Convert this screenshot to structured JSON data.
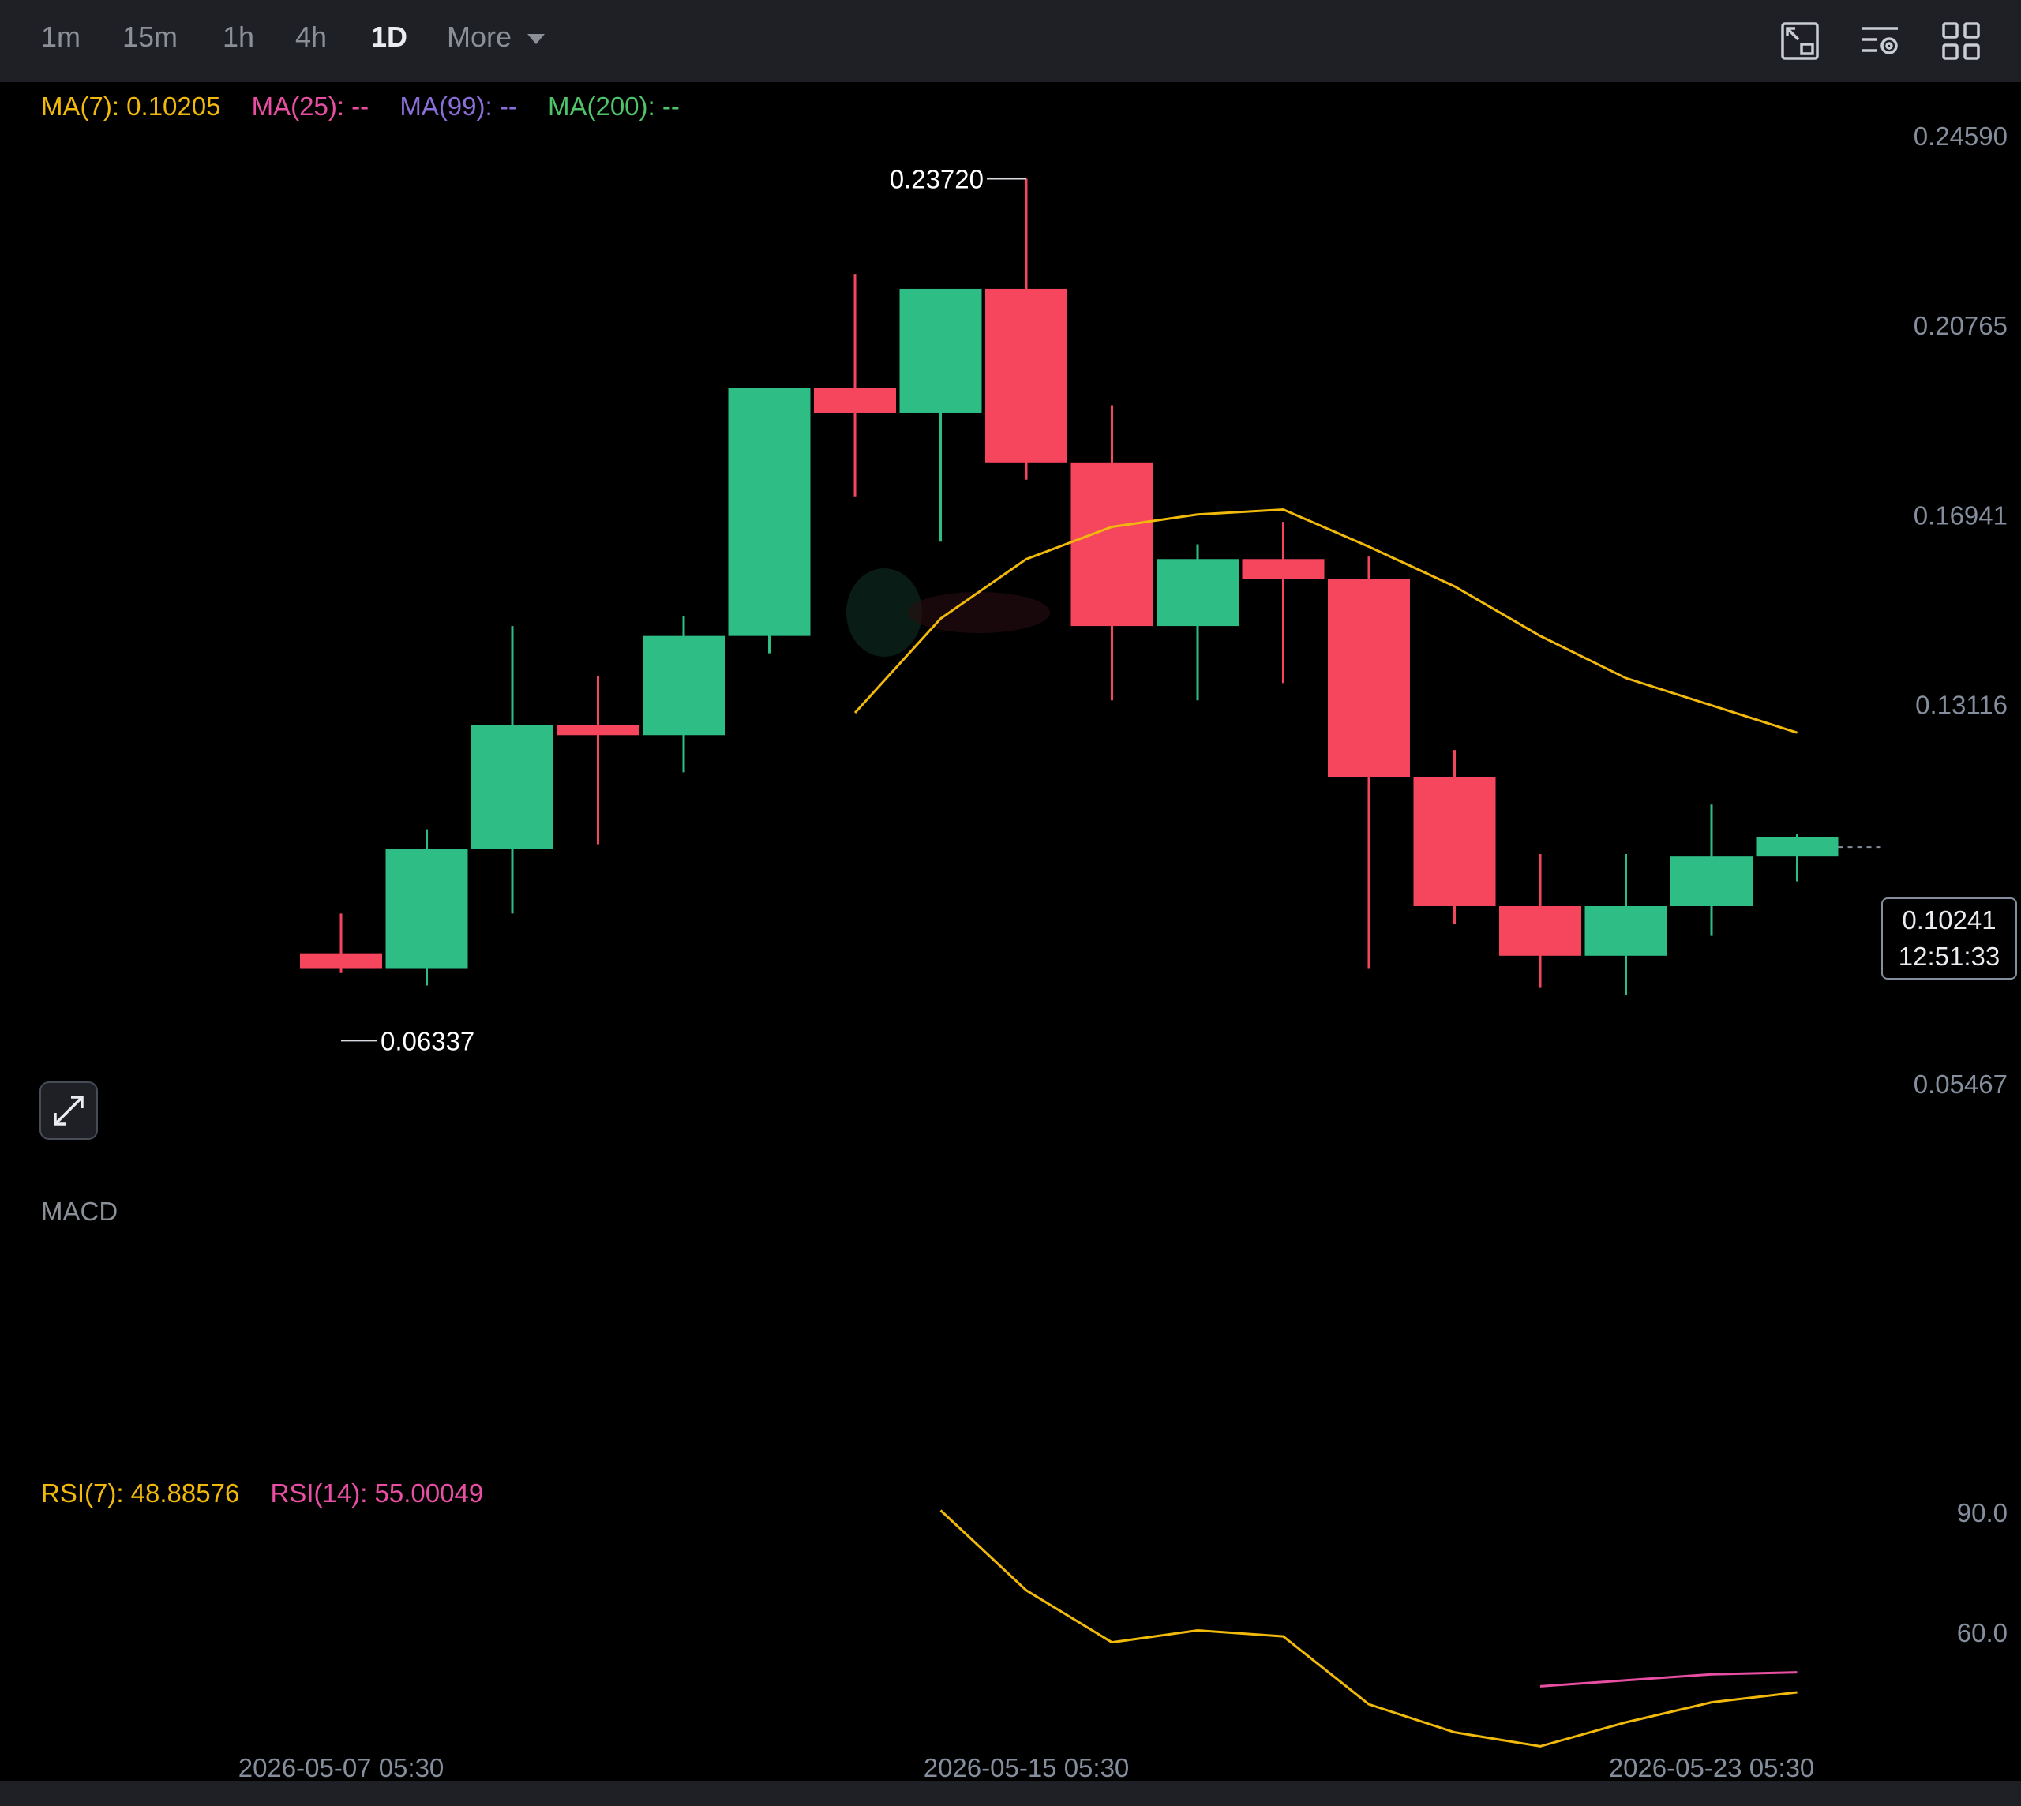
{
  "toolbar": {
    "timeframes": [
      "1m",
      "15m",
      "1h",
      "4h",
      "1D"
    ],
    "active_timeframe": "1D",
    "more_label": "More",
    "icons": [
      "chart-layout-icon",
      "indicator-settings-icon",
      "grid-layout-icon"
    ]
  },
  "legend": {
    "ma7": "MA(7): 0.10205",
    "ma25": "MA(25): --",
    "ma99": "MA(99): --",
    "ma200": "MA(200): --"
  },
  "macd_label": "MACD",
  "rsi_legend": {
    "rsi7": "RSI(7): 48.88576",
    "rsi14": "RSI(14): 55.00049"
  },
  "current_price": {
    "price": "0.10241",
    "countdown": "12:51:33"
  },
  "colors": {
    "up": "#2ebd85",
    "down": "#f6465d",
    "ma7": "#f0b90b",
    "ma25": "#e84fa3",
    "ma99": "#8a6fd8",
    "ma200": "#4fc46a",
    "rsi7": "#f0b90b",
    "rsi14": "#e84fa3"
  },
  "chart_data": {
    "type": "candlestick",
    "price_axis": {
      "ticks": [
        "0.24590",
        "0.20765",
        "0.16941",
        "0.13116",
        "0.05467"
      ],
      "range": [
        0.0386,
        0.2489
      ]
    },
    "time_axis": {
      "ticks": [
        "2026-05-07 05:30",
        "2026-05-15 05:30",
        "2026-05-23 05:30"
      ]
    },
    "annotations": {
      "high": "0.23720",
      "low": "0.06337"
    },
    "candles": [
      {
        "o": 0.081,
        "h": 0.089,
        "l": 0.077,
        "c": 0.078
      },
      {
        "o": 0.078,
        "h": 0.106,
        "l": 0.0745,
        "c": 0.102
      },
      {
        "o": 0.102,
        "h": 0.147,
        "l": 0.089,
        "c": 0.127
      },
      {
        "o": 0.127,
        "h": 0.137,
        "l": 0.103,
        "c": 0.125
      },
      {
        "o": 0.125,
        "h": 0.149,
        "l": 0.1175,
        "c": 0.145
      },
      {
        "o": 0.145,
        "h": 0.195,
        "l": 0.1415,
        "c": 0.195
      },
      {
        "o": 0.195,
        "h": 0.218,
        "l": 0.173,
        "c": 0.19
      },
      {
        "o": 0.19,
        "h": 0.2065,
        "l": 0.164,
        "c": 0.215
      },
      {
        "o": 0.215,
        "h": 0.2372,
        "l": 0.1765,
        "c": 0.18
      },
      {
        "o": 0.18,
        "h": 0.1915,
        "l": 0.132,
        "c": 0.147
      },
      {
        "o": 0.147,
        "h": 0.1635,
        "l": 0.132,
        "c": 0.1605
      },
      {
        "o": 0.1605,
        "h": 0.168,
        "l": 0.1355,
        "c": 0.1565
      },
      {
        "o": 0.1565,
        "h": 0.161,
        "l": 0.078,
        "c": 0.1165
      },
      {
        "o": 0.1165,
        "h": 0.122,
        "l": 0.087,
        "c": 0.0905
      },
      {
        "o": 0.0905,
        "h": 0.101,
        "l": 0.074,
        "c": 0.0805
      },
      {
        "o": 0.0805,
        "h": 0.101,
        "l": 0.0725,
        "c": 0.0905
      },
      {
        "o": 0.0905,
        "h": 0.111,
        "l": 0.0845,
        "c": 0.1005
      },
      {
        "o": 0.1005,
        "h": 0.105,
        "l": 0.0955,
        "c": 0.1045
      }
    ],
    "ma7": [
      null,
      null,
      null,
      null,
      null,
      null,
      0.1295,
      0.1485,
      0.1605,
      0.167,
      0.1695,
      0.1705,
      0.163,
      0.155,
      0.145,
      0.1365,
      0.131,
      0.1255
    ],
    "rsi_axis": {
      "ticks": [
        "90.0",
        "60.0"
      ],
      "range": [
        20,
        100
      ]
    },
    "rsi7": [
      null,
      null,
      null,
      null,
      null,
      null,
      null,
      90.5,
      70.5,
      57.5,
      60.5,
      59.0,
      42.0,
      35.0,
      31.5,
      37.5,
      42.5,
      45.0
    ],
    "rsi14": [
      null,
      null,
      null,
      null,
      null,
      null,
      null,
      null,
      null,
      null,
      null,
      null,
      null,
      null,
      46.5,
      48.0,
      49.5,
      50.0
    ]
  }
}
